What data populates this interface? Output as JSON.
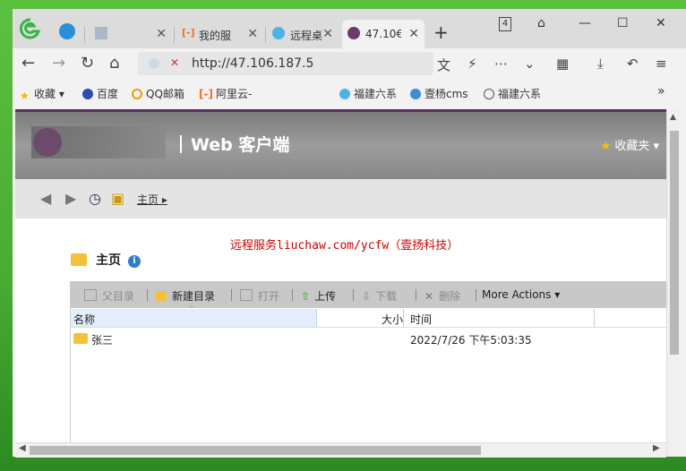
{
  "tabs": [
    {
      "title": "",
      "active": false
    },
    {
      "title": "我的服",
      "active": false
    },
    {
      "title": "远程桌",
      "active": false
    },
    {
      "title": "47.10€",
      "active": true
    }
  ],
  "window_controls": {
    "count": "4"
  },
  "address": {
    "url": "http://47.106.187.5"
  },
  "bookmarks": [
    "收藏",
    "百度",
    "QQ邮箱",
    "阿里云-",
    "福建六系",
    "壹杨cms",
    "福建六系"
  ],
  "header": {
    "title": "Web 客户端",
    "favorites": "收藏夹"
  },
  "nav": {
    "home": "主页"
  },
  "notice": "远程服务liuchaw.com/ycfw（壹扬科技）",
  "crumb": {
    "title": "主页",
    "info": "i"
  },
  "actions": {
    "parent": "父目录",
    "newdir": "新建目录",
    "open": "打开",
    "upload": "上传",
    "download": "下载",
    "delete": "删除",
    "more": "More Actions"
  },
  "columns": {
    "name": "名称",
    "size": "大小",
    "time": "时间"
  },
  "rows": [
    {
      "name": "张三",
      "size": "",
      "time": "2022/7/26 下午5:03:35"
    }
  ],
  "colors": {
    "notice": "#cc0000",
    "accent": "#5a2e5e",
    "folder": "#f3c238"
  }
}
